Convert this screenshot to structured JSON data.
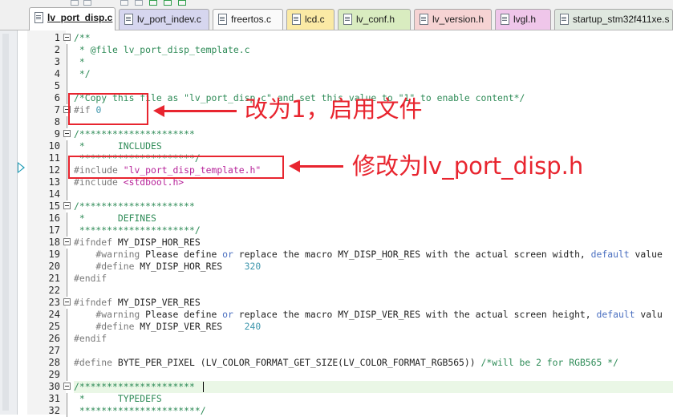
{
  "tabs": [
    {
      "label": "lv_port_disp.c",
      "active": true,
      "color": "#ffffff"
    },
    {
      "label": "lv_port_indev.c",
      "active": false,
      "color": "#d6d6ef"
    },
    {
      "label": "freertos.c",
      "active": false,
      "color": "#fafafa"
    },
    {
      "label": "lcd.c",
      "active": false,
      "color": "#fbeaa5"
    },
    {
      "label": "lv_conf.h",
      "active": false,
      "color": "#d9ecc0"
    },
    {
      "label": "lv_version.h",
      "active": false,
      "color": "#f6d3d3"
    },
    {
      "label": "lvgl.h",
      "active": false,
      "color": "#efc6ea"
    },
    {
      "label": "startup_stm32f411xe.s",
      "active": false,
      "color": "#e0e8e0"
    }
  ],
  "code_lines": [
    {
      "n": "1",
      "fold": true,
      "segs": [
        {
          "t": "/**",
          "c": "comment"
        }
      ]
    },
    {
      "n": "2",
      "segs": [
        {
          "t": " * @file lv_port_disp_template.c",
          "c": "comment"
        }
      ]
    },
    {
      "n": "3",
      "segs": [
        {
          "t": " *",
          "c": "comment"
        }
      ]
    },
    {
      "n": "4",
      "segs": [
        {
          "t": " */",
          "c": "comment"
        }
      ]
    },
    {
      "n": "5",
      "segs": []
    },
    {
      "n": "6",
      "segs": [
        {
          "t": "/*Copy this file as \"lv_port_disp.c\" and set this value to \"1\" to enable content*/",
          "c": "comment"
        }
      ]
    },
    {
      "n": "7",
      "fold": true,
      "segs": [
        {
          "t": "#if ",
          "c": "pp"
        },
        {
          "t": "0",
          "c": "num"
        }
      ]
    },
    {
      "n": "8",
      "segs": []
    },
    {
      "n": "9",
      "fold": true,
      "segs": [
        {
          "t": "/*********************",
          "c": "comment"
        }
      ]
    },
    {
      "n": "10",
      "segs": [
        {
          "t": " *      INCLUDES",
          "c": "comment"
        }
      ]
    },
    {
      "n": "11",
      "segs": [
        {
          "t": " *********************/",
          "c": "comment"
        }
      ]
    },
    {
      "n": "12",
      "segs": [
        {
          "t": "#include ",
          "c": "pp"
        },
        {
          "t": "\"lv_port_disp_template.h\"",
          "c": "str"
        }
      ]
    },
    {
      "n": "13",
      "segs": [
        {
          "t": "#include ",
          "c": "pp"
        },
        {
          "t": "<stdbool.h>",
          "c": "str"
        }
      ]
    },
    {
      "n": "14",
      "segs": []
    },
    {
      "n": "15",
      "fold": true,
      "segs": [
        {
          "t": "/*********************",
          "c": "comment"
        }
      ]
    },
    {
      "n": "16",
      "segs": [
        {
          "t": " *      DEFINES",
          "c": "comment"
        }
      ]
    },
    {
      "n": "17",
      "segs": [
        {
          "t": " *********************/",
          "c": "comment"
        }
      ]
    },
    {
      "n": "18",
      "fold": true,
      "segs": [
        {
          "t": "#ifndef ",
          "c": "pp"
        },
        {
          "t": "MY_DISP_HOR_RES",
          "c": "plain"
        }
      ]
    },
    {
      "n": "19",
      "segs": [
        {
          "t": "    #warning ",
          "c": "pp"
        },
        {
          "t": "Please define ",
          "c": "plain"
        },
        {
          "t": "or",
          "c": "kw"
        },
        {
          "t": " replace the macro MY_DISP_HOR_RES with the actual screen width, ",
          "c": "plain"
        },
        {
          "t": "default",
          "c": "kw"
        },
        {
          "t": " value",
          "c": "plain"
        }
      ]
    },
    {
      "n": "20",
      "segs": [
        {
          "t": "    #define ",
          "c": "pp"
        },
        {
          "t": "MY_DISP_HOR_RES    ",
          "c": "plain"
        },
        {
          "t": "320",
          "c": "num"
        }
      ]
    },
    {
      "n": "21",
      "segs": [
        {
          "t": "#endif",
          "c": "pp"
        }
      ]
    },
    {
      "n": "22",
      "segs": []
    },
    {
      "n": "23",
      "fold": true,
      "segs": [
        {
          "t": "#ifndef ",
          "c": "pp"
        },
        {
          "t": "MY_DISP_VER_RES",
          "c": "plain"
        }
      ]
    },
    {
      "n": "24",
      "segs": [
        {
          "t": "    #warning ",
          "c": "pp"
        },
        {
          "t": "Please define ",
          "c": "plain"
        },
        {
          "t": "or",
          "c": "kw"
        },
        {
          "t": " replace the macro MY_DISP_VER_RES with the actual screen height, ",
          "c": "plain"
        },
        {
          "t": "default",
          "c": "kw"
        },
        {
          "t": " valu",
          "c": "plain"
        }
      ]
    },
    {
      "n": "25",
      "segs": [
        {
          "t": "    #define ",
          "c": "pp"
        },
        {
          "t": "MY_DISP_VER_RES    ",
          "c": "plain"
        },
        {
          "t": "240",
          "c": "num"
        }
      ]
    },
    {
      "n": "26",
      "segs": [
        {
          "t": "#endif",
          "c": "pp"
        }
      ]
    },
    {
      "n": "27",
      "segs": []
    },
    {
      "n": "28",
      "segs": [
        {
          "t": "#define ",
          "c": "pp"
        },
        {
          "t": "BYTE_PER_PIXEL (LV_COLOR_FORMAT_GET_SIZE(LV_COLOR_FORMAT_RGB565)) ",
          "c": "plain"
        },
        {
          "t": "/*will be 2 for RGB565 */",
          "c": "comment"
        }
      ]
    },
    {
      "n": "29",
      "segs": []
    },
    {
      "n": "30",
      "fold": true,
      "segs": [
        {
          "t": "/*********************",
          "c": "comment"
        }
      ]
    },
    {
      "n": "31",
      "segs": [
        {
          "t": " *      TYPEDEFS",
          "c": "comment"
        }
      ]
    },
    {
      "n": "32",
      "segs": [
        {
          "t": " **********************/",
          "c": "comment"
        }
      ]
    }
  ],
  "annotations": {
    "text1": "改为1，启用文件",
    "text2": "修改为lv_port_disp.h",
    "color": "#e8252f"
  }
}
